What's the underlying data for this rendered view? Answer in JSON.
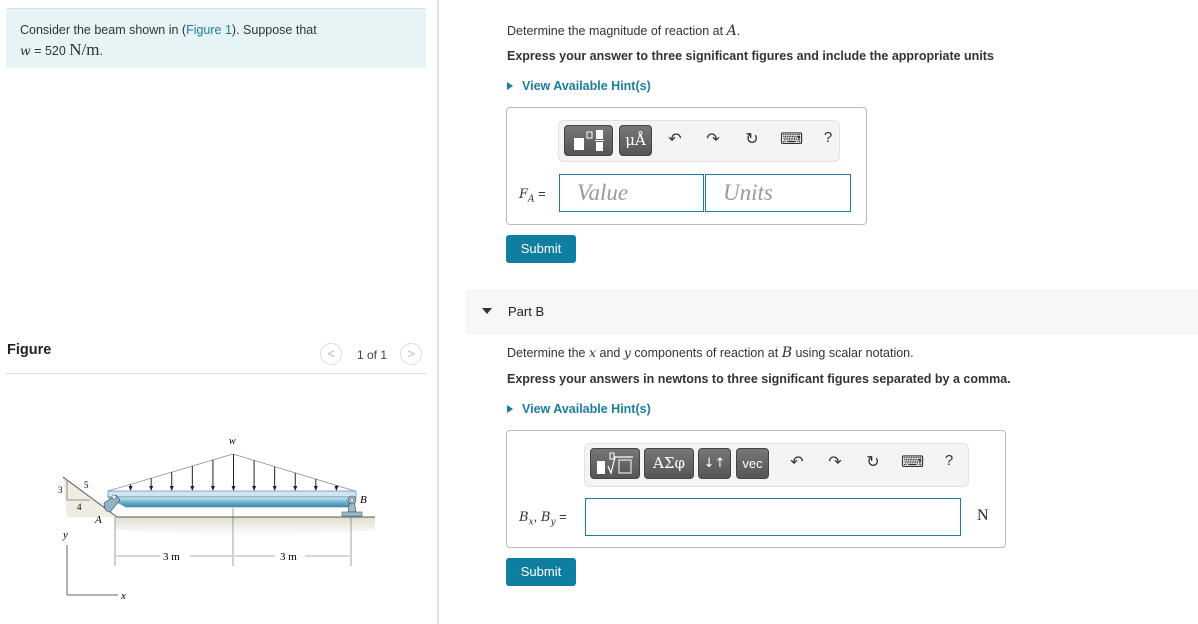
{
  "problem": {
    "intro_text": "Consider the beam shown in (",
    "figure_link": "Figure 1",
    "intro_suffix": "). Suppose that",
    "w_symbol": "w",
    "w_equals": " = 520 ",
    "w_units": "N/m",
    "w_period": "."
  },
  "figure_panel": {
    "title": "Figure",
    "counter": "1 of 1",
    "prev_icon": "<",
    "next_icon": ">",
    "labels": {
      "w": "w",
      "A": "A",
      "B": "B",
      "slope_3": "3",
      "slope_4": "4",
      "slope_5": "5",
      "dim_left": "3 m",
      "dim_right": "3 m",
      "axis_x": "x",
      "axis_y": "y"
    }
  },
  "part_a": {
    "question_prefix": "Determine the magnitude of reaction at ",
    "question_var": "A",
    "question_suffix": ".",
    "instruction": "Express your answer to three significant figures and include the appropriate units",
    "hint_label": "View Available Hint(s)",
    "toolbar": {
      "template_btn": "templates",
      "units_btn": "μÅ",
      "undo": "↶",
      "redo": "↷",
      "reset": "↻",
      "keyboard": "⌨",
      "help": "?"
    },
    "answer_label": "F",
    "answer_subscript": "A",
    "answer_eq": " =",
    "value_placeholder": "Value",
    "units_placeholder": "Units",
    "submit_label": "Submit"
  },
  "part_b": {
    "header": "Part B",
    "question_prefix": "Determine the ",
    "question_x": "x",
    "question_and": " and ",
    "question_y": "y",
    "question_mid": " components of reaction at ",
    "question_var": "B",
    "question_suffix": " using scalar notation.",
    "instruction": "Express your answers in newtons to three significant figures separated by a comma.",
    "hint_label": "View Available Hint(s)",
    "toolbar": {
      "template_btn": "√□",
      "greek_btn": "ΑΣφ",
      "arrows_btn": "↓↑",
      "vec_btn": "vec",
      "undo": "↶",
      "redo": "↷",
      "reset": "↻",
      "keyboard": "⌨",
      "help": "?"
    },
    "answer_label": "B",
    "answer_sub_x": "x",
    "answer_comma": ", ",
    "answer_label2": "B",
    "answer_sub_y": "y",
    "answer_eq": " =",
    "answer_value": "",
    "units": "N",
    "submit_label": "Submit"
  }
}
